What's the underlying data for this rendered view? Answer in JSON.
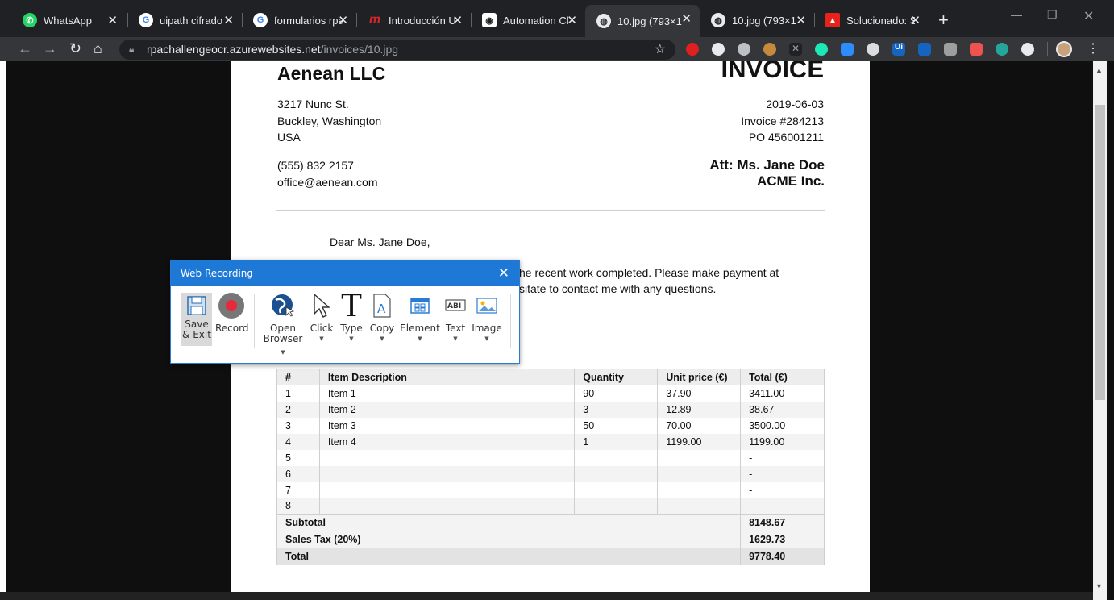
{
  "browser": {
    "tabs": [
      {
        "label": "WhatsApp",
        "icon": "whatsapp-icon",
        "color": "#25d366",
        "glyph": "✆",
        "active": false
      },
      {
        "label": "uipath cifrado",
        "icon": "google-icon",
        "color": "#ffffff",
        "glyph": "G",
        "active": false
      },
      {
        "label": "formularios rpa",
        "icon": "google-icon",
        "color": "#ffffff",
        "glyph": "G",
        "active": false
      },
      {
        "label": "Introducción U",
        "icon": "m-logo-icon",
        "color": "#d6262c",
        "glyph": "m",
        "active": false
      },
      {
        "label": "Automation Cl",
        "icon": "robot-icon",
        "color": "#ffffff",
        "glyph": "◉",
        "active": false
      },
      {
        "label": "10.jpg (793×1",
        "icon": "globe-icon",
        "color": "#e8eaed",
        "glyph": "◍",
        "active": true
      },
      {
        "label": "10.jpg (793×1",
        "icon": "globe-icon",
        "color": "#e8eaed",
        "glyph": "◍",
        "active": false
      },
      {
        "label": "Solucionado: S",
        "icon": "adobe-icon",
        "color": "#e5231b",
        "glyph": "▲",
        "active": false
      }
    ],
    "new_tab": "+",
    "url_host": "rpachallengeocr.azurewebsites.net",
    "url_path": "/invoices/10.jpg"
  },
  "invoice": {
    "company": "Aenean LLC",
    "title": "INVOICE",
    "address": [
      "3217 Nunc St.",
      "Buckley, Washington",
      "USA"
    ],
    "phone": "(555) 832 2157",
    "email": "office@aenean.com",
    "date": "2019-06-03",
    "invoice_no": "Invoice #284213",
    "po": "PO 456001211",
    "att": "Att: Ms. Jane Doe",
    "att_company": "ACME Inc.",
    "greeting": "Dear Ms. Jane Doe,",
    "body_line1": "he recent work completed. Please make payment at",
    "body_line2": "sitate to contact me with any questions.",
    "table_headers": [
      "#",
      "Item Description",
      "Quantity",
      "Unit price (€)",
      "Total (€)"
    ],
    "rows": [
      [
        "1",
        "Item 1",
        "90",
        "37.90",
        "3411.00"
      ],
      [
        "2",
        "Item 2",
        "3",
        "12.89",
        "38.67"
      ],
      [
        "3",
        "Item 3",
        "50",
        "70.00",
        "3500.00"
      ],
      [
        "4",
        "Item 4",
        "1",
        "1199.00",
        "1199.00"
      ],
      [
        "5",
        "",
        "",
        "",
        "-"
      ],
      [
        "6",
        "",
        "",
        "",
        "-"
      ],
      [
        "7",
        "",
        "",
        "",
        "-"
      ],
      [
        "8",
        "",
        "",
        "",
        "-"
      ]
    ],
    "subtotal_label": "Subtotal",
    "subtotal": "8148.67",
    "tax_label": "Sales Tax (20%)",
    "tax": "1629.73",
    "total_label": "Total",
    "total": "9778.40"
  },
  "recorder": {
    "title": "Web Recording",
    "buttons": [
      {
        "label1": "Save",
        "label2": "& Exit",
        "icon": "floppy-disk-icon",
        "caret": false
      },
      {
        "label1": "Record",
        "label2": "",
        "icon": "record-icon",
        "caret": false
      },
      {
        "label1": "Open",
        "label2": "Browser",
        "icon": "globe-cursor-icon",
        "caret": true
      },
      {
        "label1": "Click",
        "label2": "",
        "icon": "cursor-arrow-icon",
        "caret": true
      },
      {
        "label1": "Type",
        "label2": "",
        "icon": "type-t-icon",
        "caret": true
      },
      {
        "label1": "Copy",
        "label2": "",
        "icon": "copy-document-icon",
        "caret": true
      },
      {
        "label1": "Element",
        "label2": "",
        "icon": "element-grid-icon",
        "caret": true
      },
      {
        "label1": "Text",
        "label2": "",
        "icon": "text-ocr-icon",
        "caret": true
      },
      {
        "label1": "Image",
        "label2": "",
        "icon": "image-icon",
        "caret": true
      }
    ]
  },
  "colors": {
    "recorder_header": "#1e78d6",
    "record_dot": "#e8283b"
  }
}
